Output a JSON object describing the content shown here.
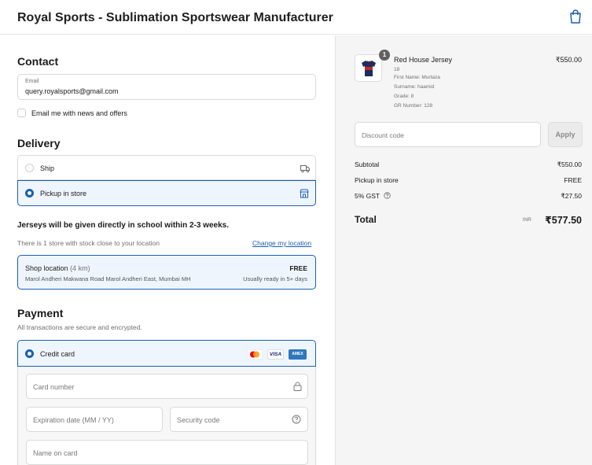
{
  "header": {
    "store_name": "Royal Sports - Sublimation Sportswear Manufacturer"
  },
  "contact": {
    "heading": "Contact",
    "email_label": "Email",
    "email_value": "query.royalsports@gmail.com",
    "newsletter_label": "Email me with news and offers"
  },
  "delivery": {
    "heading": "Delivery",
    "ship_label": "Ship",
    "pickup_label": "Pickup in store",
    "note": "Jerseys will be given directly in school within 2-3 weeks.",
    "store_count_text": "There is 1 store with stock close to your location",
    "change_location": "Change my location",
    "shop_name": "Shop location",
    "shop_distance": "(4 km)",
    "shop_address": "Marol Andheri Makwana Road Marol Andheri East, Mumbai MH",
    "shop_price": "FREE",
    "shop_ready": "Usually ready in 5+ days"
  },
  "payment": {
    "heading": "Payment",
    "subheading": "All transactions are secure and encrypted.",
    "credit_card_label": "Credit card",
    "visa_label": "VISA",
    "amex_label": "AMEX",
    "card_number_placeholder": "Card number",
    "expiry_placeholder": "Expiration date (MM / YY)",
    "security_placeholder": "Security code",
    "name_placeholder": "Name on card"
  },
  "summary": {
    "item_qty": "1",
    "item_name": "Red House Jersey",
    "item_variant": "18",
    "item_props": [
      "First Name: Murtaza",
      "Surname: haamid",
      "Grade: 8",
      "GR Number: 128"
    ],
    "item_price": "₹550.00",
    "discount_placeholder": "Discount code",
    "apply_label": "Apply",
    "subtotal_label": "Subtotal",
    "subtotal_value": "₹550.00",
    "pickup_label": "Pickup in store",
    "pickup_value": "FREE",
    "tax_label": "5% GST",
    "tax_value": "₹27.50",
    "total_label": "Total",
    "currency": "INR",
    "total_value": "₹577.50"
  },
  "colors": {
    "accent": "#1a5fb4",
    "selected_bg": "#eff5fd",
    "sidebar_bg": "#f5f5f5"
  },
  "icons": [
    "bag-icon",
    "truck-icon",
    "store-icon",
    "lock-icon",
    "help-circle-icon",
    "info-icon",
    "jersey-image"
  ]
}
